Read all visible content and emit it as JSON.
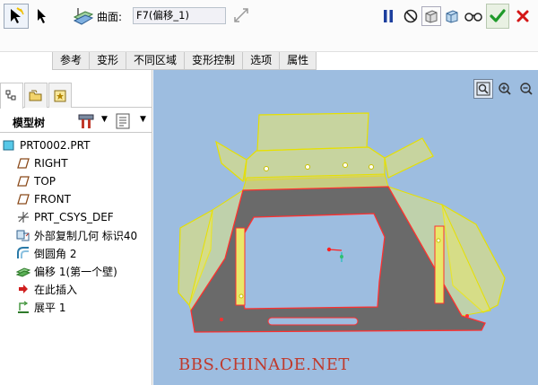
{
  "dashboard": {
    "selection_tool_icon": "arrow-select-active-icon",
    "reference_label": "曲面:",
    "reference_value": "F7(偏移_1)",
    "controls": {
      "pause": "pause-icon",
      "no_preview": "no-preview-icon",
      "preview": "preview-icon",
      "verify": "glasses-icon",
      "ok": "checkmark-icon",
      "cancel": "x-icon"
    }
  },
  "tabs": [
    "参考",
    "变形",
    "不同区域",
    "变形控制",
    "选项",
    "属性"
  ],
  "left_panel": {
    "tree_title": "模型树",
    "tree_items": [
      {
        "label": "PRT0002.PRT",
        "icon": "part-icon"
      },
      {
        "label": "RIGHT",
        "icon": "datum-plane-icon"
      },
      {
        "label": "TOP",
        "icon": "datum-plane-icon"
      },
      {
        "label": "FRONT",
        "icon": "datum-plane-icon"
      },
      {
        "label": "PRT_CSYS_DEF",
        "icon": "csys-icon"
      },
      {
        "label": "外部复制几何 标识40",
        "icon": "copy-geometry-icon"
      },
      {
        "label": "倒圆角 2",
        "icon": "round-icon"
      },
      {
        "label": "偏移 1(第一个壁)",
        "icon": "offset-wall-icon"
      },
      {
        "label": "在此插入",
        "icon": "insert-here-arrow-icon"
      },
      {
        "label": "展平 1",
        "icon": "flatten-icon"
      }
    ]
  },
  "viewport": {
    "watermark": "BBS.CHINADE.NET",
    "background_color": "#9dbde0",
    "plate_color": "#6a6a6a",
    "highlight_color": "#e9e86a",
    "edge_color": "#ff3030"
  }
}
